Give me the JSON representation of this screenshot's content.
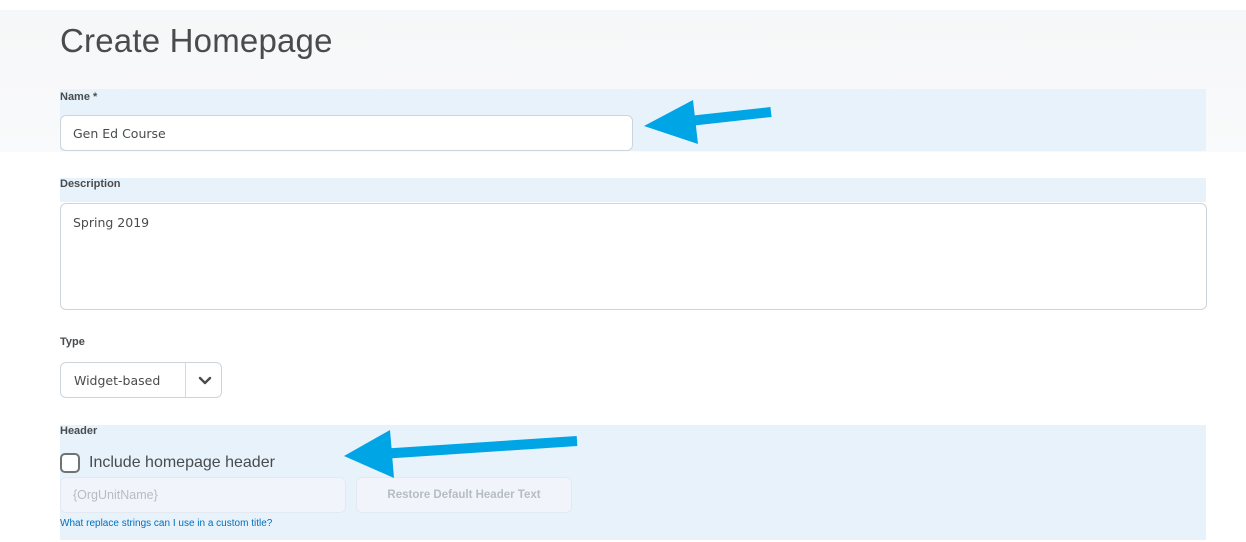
{
  "page": {
    "title": "Create Homepage"
  },
  "name_field": {
    "label": "Name *",
    "value": "Gen Ed Course"
  },
  "description_field": {
    "label": "Description",
    "value": "Spring 2019"
  },
  "type_field": {
    "label": "Type",
    "selected": "Widget-based"
  },
  "header_section": {
    "label": "Header",
    "checkbox_label": "Include homepage header",
    "checkbox_checked": false,
    "header_text_placeholder": "{OrgUnitName}",
    "restore_button_label": "Restore Default Header Text",
    "help_link_text": "What replace strings can I use in a custom title?"
  },
  "annotations": {
    "arrow_color": "#00a5e6",
    "icon": "arrow-left-icon"
  },
  "colors": {
    "highlight_band": "#e8f2fa",
    "link": "#006fbf",
    "page_background": "#ffffff"
  }
}
